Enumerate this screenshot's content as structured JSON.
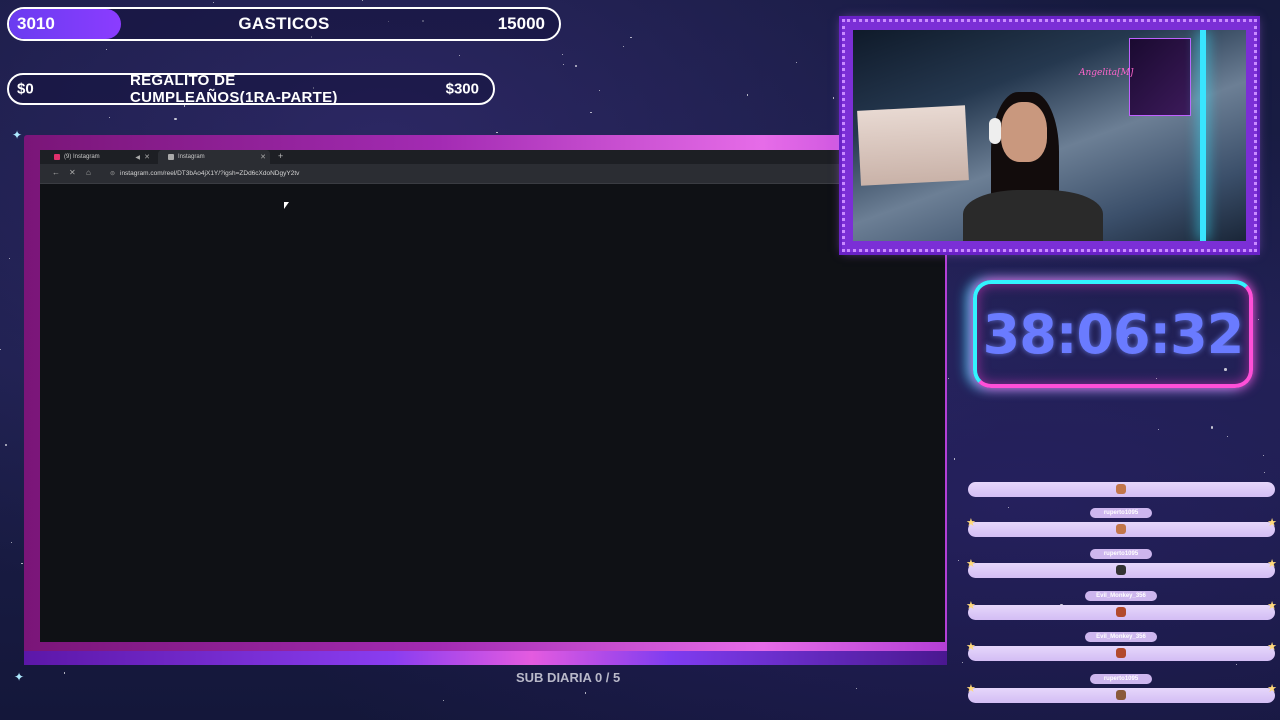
{
  "goals": {
    "top": {
      "current": "3010",
      "title": "GASTICOS",
      "target": "15000",
      "progress": 0.2
    },
    "second": {
      "current": "$0",
      "title": "REGALITO DE CUMPLEAÑOS(1RA-PARTE)",
      "target": "$300",
      "progress": 0
    }
  },
  "browser": {
    "tabs": [
      {
        "label": "(9) Instagram",
        "muted_icon": "speaker-icon"
      },
      {
        "label": "Instagram"
      }
    ],
    "new_tab": "+",
    "url": "instagram.com/reel/DT3bAo4jX1Y/?igsh=ZDd6cXdoNDgyY2tv",
    "nav": {
      "back": "←",
      "forward": "→",
      "stop": "✕",
      "home": "⌂"
    }
  },
  "webcam": {
    "sign_text": "Angelita[M]"
  },
  "timer": {
    "value": "38:06:32"
  },
  "chat": {
    "messages": [
      {
        "user": ""
      },
      {
        "user": "ruperto1095"
      },
      {
        "user": "ruperto1095"
      },
      {
        "user": "Evil_Monkey_356"
      },
      {
        "user": "Evil_Monkey_356"
      },
      {
        "user": "ruperto1095"
      }
    ]
  },
  "footer": {
    "sub_daily": "SUB DIARIA 0 / 5"
  },
  "colors": {
    "accent": "#7b2fd6",
    "timer": "#6a7bff",
    "neon_pink": "#ff4fd8",
    "neon_cyan": "#33f3ff"
  }
}
